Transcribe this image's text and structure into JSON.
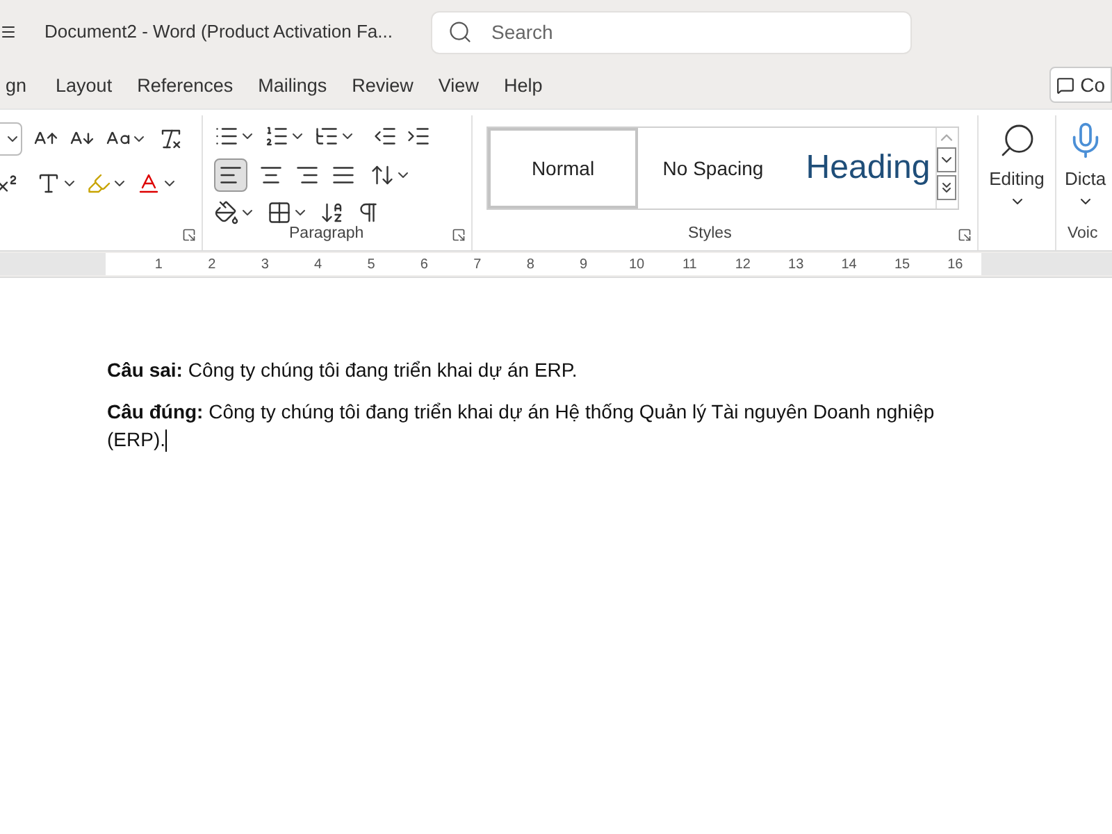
{
  "title_bar": {
    "title": "Document2  -  Word (Product Activation Fa...",
    "search": {
      "placeholder": "Search"
    },
    "comments_button": "Co"
  },
  "tabs": [
    {
      "label": "gn",
      "selected": false
    },
    {
      "label": "Layout",
      "selected": false
    },
    {
      "label": "References",
      "selected": false
    },
    {
      "label": "Mailings",
      "selected": false
    },
    {
      "label": "Review",
      "selected": false
    },
    {
      "label": "View",
      "selected": false
    },
    {
      "label": "Help",
      "selected": false
    }
  ],
  "ribbon": {
    "paragraph": {
      "label": "Paragraph",
      "align_left_selected": true
    },
    "styles": {
      "label": "Styles",
      "items": [
        {
          "label": "Normal",
          "selected": true,
          "kind": "normal"
        },
        {
          "label": "No Spacing",
          "selected": false,
          "kind": "normal"
        },
        {
          "label": "Heading",
          "selected": false,
          "kind": "heading"
        }
      ]
    },
    "editing": {
      "label": "Editing"
    },
    "voice": {
      "button": "Dicta",
      "label": "Voic"
    }
  },
  "ruler": {
    "numbers": [
      "1",
      "2",
      "3",
      "4",
      "5",
      "6",
      "7",
      "8",
      "9",
      "10",
      "11",
      "12",
      "13",
      "14",
      "15",
      "16"
    ]
  },
  "document": {
    "paragraphs": [
      {
        "text": "**Câu sai:** Công ty chúng tôi đang triển khai dự án ERP.",
        "caret": false
      },
      {
        "text": "**Câu đúng:** Công ty chúng tôi đang triển khai dự án Hệ thống Quản lý Tài nguyên Doanh nghiệp (ERP).",
        "caret": true
      }
    ]
  }
}
